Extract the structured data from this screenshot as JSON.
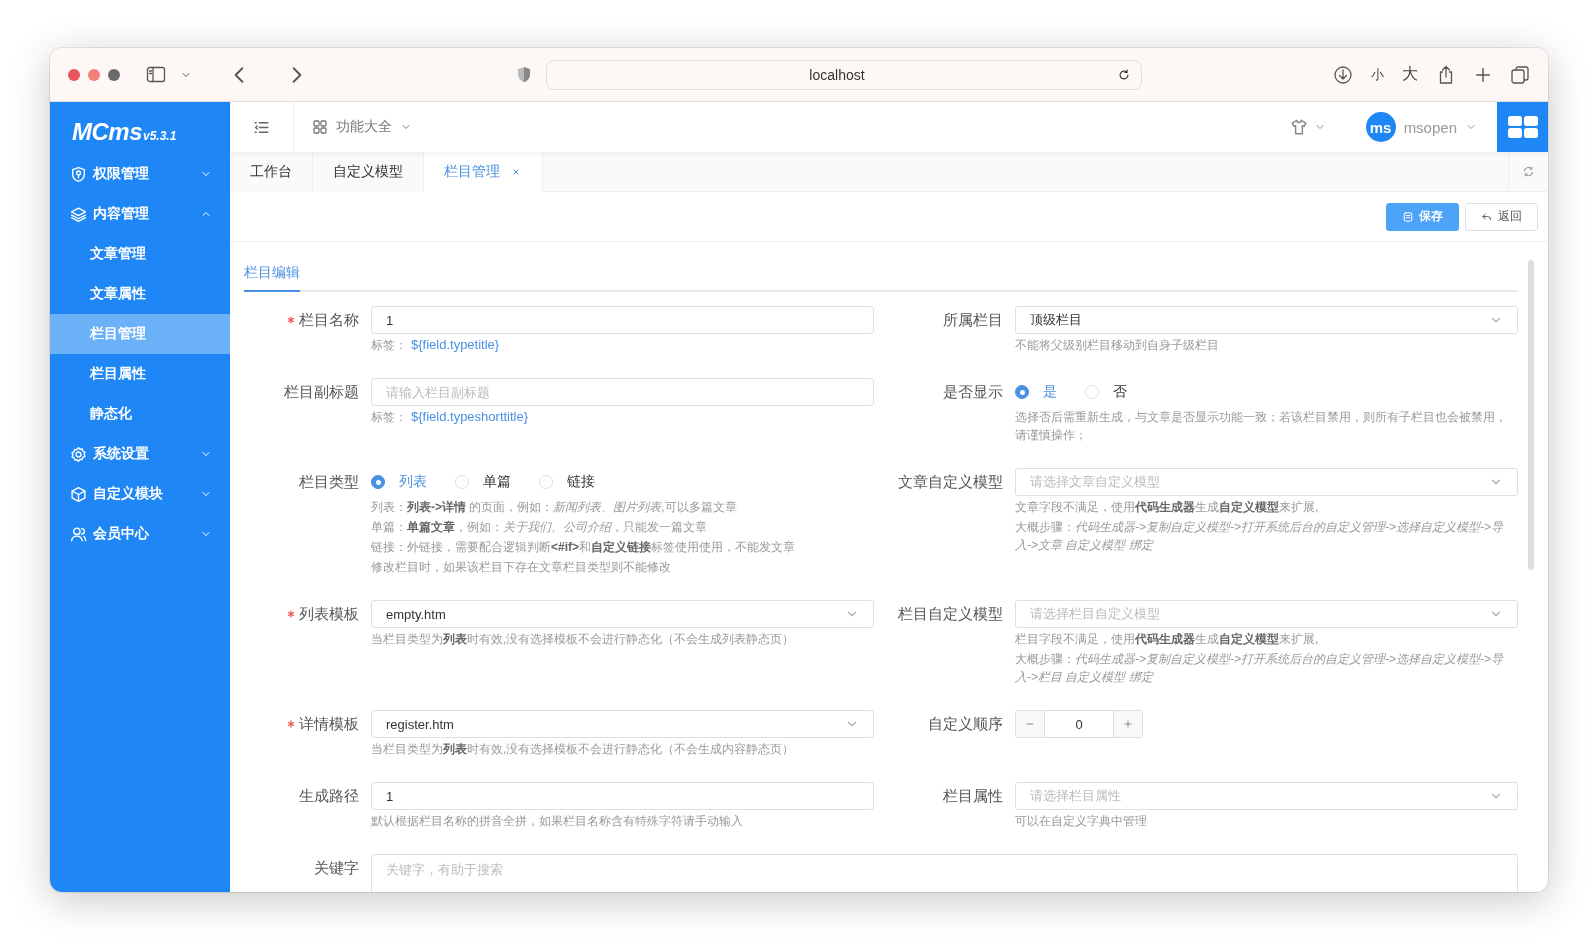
{
  "browser": {
    "url": "localhost",
    "text_smaller": "小",
    "text_larger": "大"
  },
  "sidebar": {
    "logo": "MCms",
    "version": "v5.3.1",
    "items": [
      {
        "label": "权限管理",
        "expanded": false
      },
      {
        "label": "内容管理",
        "expanded": true,
        "children": [
          {
            "label": "文章管理",
            "selected": false
          },
          {
            "label": "文章属性",
            "selected": false
          },
          {
            "label": "栏目管理",
            "selected": true
          },
          {
            "label": "栏目属性",
            "selected": false
          },
          {
            "label": "静态化",
            "selected": false
          }
        ]
      },
      {
        "label": "系统设置",
        "expanded": false
      },
      {
        "label": "自定义模块",
        "expanded": false
      },
      {
        "label": "会员中心",
        "expanded": false
      }
    ]
  },
  "header": {
    "menu": "功能大全",
    "user": {
      "avatar": "ms",
      "name": "msopen"
    }
  },
  "tabs": [
    {
      "label": "工作台",
      "selected": false,
      "closable": false
    },
    {
      "label": "自定义模型",
      "selected": false,
      "closable": false
    },
    {
      "label": "栏目管理",
      "selected": true,
      "closable": true
    }
  ],
  "actions": [
    {
      "label": "保存",
      "kind": "primary"
    },
    {
      "label": "返回",
      "kind": "default"
    }
  ],
  "form": {
    "section": "栏目编辑",
    "rows": [
      {
        "fields": [
          {
            "label": "栏目名称",
            "required": true,
            "kind": "input",
            "value": "1",
            "tag_label": "标签：",
            "tag": "${field.typetitle}"
          },
          {
            "label": "所属栏目",
            "required": false,
            "kind": "select",
            "value": "顶级栏目",
            "help": [
              "不能将父级别栏目移动到自身子级栏目"
            ]
          }
        ]
      },
      {
        "fields": [
          {
            "label": "栏目副标题",
            "required": false,
            "kind": "input",
            "placeholder": "请输入栏目副标题",
            "tag_label": "标签：",
            "tag": "${field.typeshorttitle}"
          },
          {
            "label": "是否显示",
            "required": false,
            "kind": "radio",
            "options": [
              {
                "label": "是",
                "selected": true
              },
              {
                "label": "否",
                "selected": false
              }
            ],
            "help": [
              "选择否后需重新生成，与文章是否显示功能一致；若该栏目禁用，则所有子栏目也会被禁用，请谨慎操作；"
            ]
          }
        ]
      },
      {
        "fields": [
          {
            "label": "栏目类型",
            "required": false,
            "kind": "radio",
            "options": [
              {
                "label": "列表",
                "selected": true
              },
              {
                "label": "单篇",
                "selected": false
              },
              {
                "label": "链接",
                "selected": false
              }
            ],
            "help": [
              "列表：**列表->详情** 的页面，例如：*新闻列表、图片列表*,可以多篇文章",
              "单篇：**单篇文章**，例如：*关于我们、公司介绍*，只能发一篇文章",
              "链接：外链接，需要配合逻辑判断**<#if>**和**自定义链接**标签使用使用，不能发文章",
              "修改栏目时，如果该栏目下存在文章栏目类型则不能修改"
            ]
          },
          {
            "label": "文章自定义模型",
            "required": false,
            "kind": "select",
            "placeholder": "请选择文章自定义模型",
            "help": [
              "文章字段不满足，使用**代码生成器**生成**自定义模型**来扩展,",
              "大概步骤：*代码生成器->复制自定义模型->打开系统后台的自定义管理->选择自定义模型->导入->文章 自定义模型 绑定*"
            ]
          }
        ]
      },
      {
        "fields": [
          {
            "label": "列表模板",
            "required": true,
            "kind": "select",
            "value": "empty.htm",
            "help": [
              "当栏目类型为**列表**时有效,没有选择模板不会进行静态化（不会生成列表静态页）"
            ]
          },
          {
            "label": "栏目自定义模型",
            "required": false,
            "kind": "select",
            "placeholder": "请选择栏目自定义模型",
            "help": [
              "栏目字段不满足，使用**代码生成器**生成**自定义模型**来扩展,",
              "大概步骤：*代码生成器->复制自定义模型->打开系统后台的自定义管理->选择自定义模型->导入->栏目 自定义模型 绑定*"
            ]
          }
        ]
      },
      {
        "fields": [
          {
            "label": "详情模板",
            "required": true,
            "kind": "select",
            "value": "register.htm",
            "help": [
              "当栏目类型为**列表**时有效,没有选择模板不会进行静态化（不会生成内容静态页）"
            ]
          },
          {
            "label": "自定义顺序",
            "required": false,
            "kind": "number",
            "value": "0"
          }
        ]
      },
      {
        "fields": [
          {
            "label": "生成路径",
            "required": false,
            "kind": "input",
            "value": "1",
            "help": [
              "默认根据栏目名称的拼音全拼，如果栏目名称含有特殊字符请手动输入"
            ]
          },
          {
            "label": "栏目属性",
            "required": false,
            "kind": "select",
            "placeholder": "请选择栏目属性",
            "help": [
              "可以在自定义字典中管理"
            ]
          }
        ]
      },
      {
        "fields": [
          {
            "label": "关键字",
            "required": false,
            "kind": "textarea",
            "placeholder": "关键字，有助于搜索"
          }
        ]
      }
    ]
  }
}
